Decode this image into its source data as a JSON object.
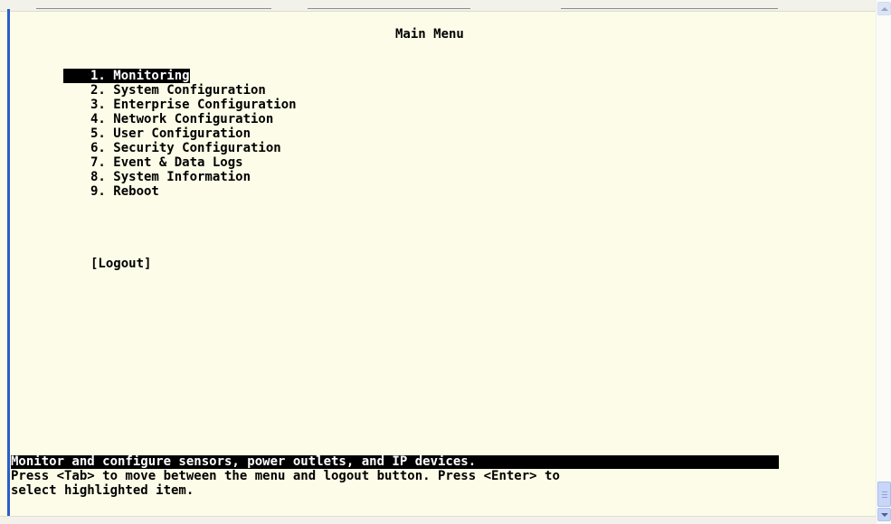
{
  "title": "Main Menu",
  "menu": {
    "selected_index": 0,
    "items": [
      {
        "label": "1. Monitoring"
      },
      {
        "label": "2. System Configuration"
      },
      {
        "label": "3. Enterprise Configuration"
      },
      {
        "label": "4. Network Configuration"
      },
      {
        "label": "5. User Configuration"
      },
      {
        "label": "6. Security Configuration"
      },
      {
        "label": "7. Event & Data Logs"
      },
      {
        "label": "8. System Information"
      },
      {
        "label": "9. Reboot"
      }
    ]
  },
  "logout_label": "[Logout]",
  "status": {
    "description": "Monitor and configure sensors, power outlets, and IP devices.",
    "help_line1": "Press <Tab> to move between the menu and logout button. Press <Enter> to",
    "help_line2": "select highlighted item."
  },
  "colors": {
    "terminal_bg": "#fdfce8",
    "text": "#000000",
    "highlight_bg": "#000000",
    "highlight_text": "#ffffff",
    "left_border": "#2a5fc8"
  },
  "icons": {
    "scroll_up": "chevron-up-icon",
    "scroll_down": "chevron-down-icon"
  }
}
